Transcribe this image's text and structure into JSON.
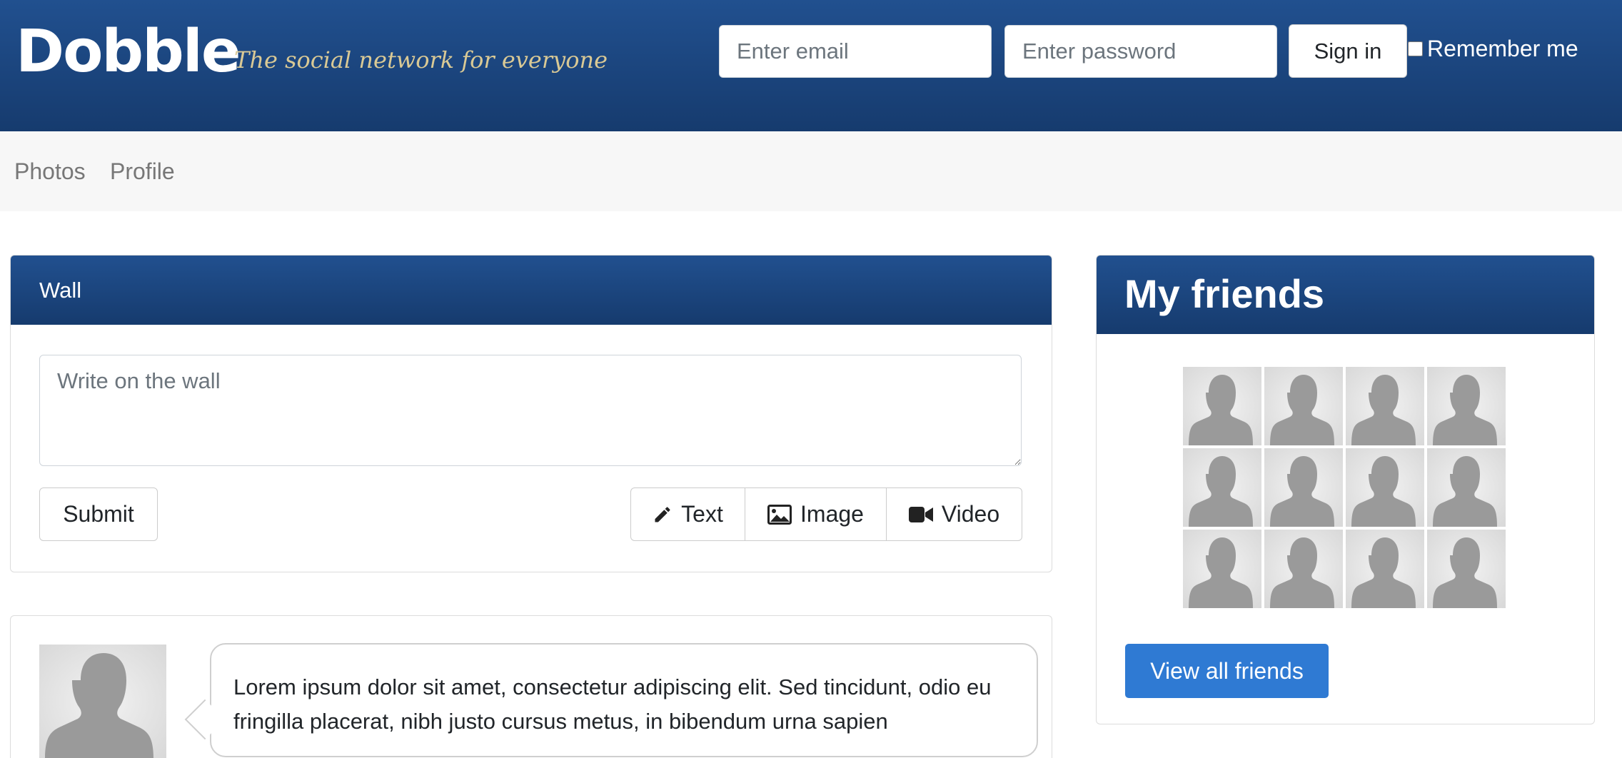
{
  "header": {
    "logo": "Dobble",
    "tagline": "The social network for everyone",
    "email_placeholder": "Enter email",
    "password_placeholder": "Enter password",
    "signin_label": "Sign in",
    "remember_label": "Remember me"
  },
  "nav": {
    "items": [
      {
        "label": "Photos"
      },
      {
        "label": "Profile"
      }
    ]
  },
  "wall": {
    "title": "Wall",
    "placeholder": "Write on the wall",
    "submit_label": "Submit",
    "type_buttons": [
      {
        "label": "Text",
        "icon": "pencil-icon"
      },
      {
        "label": "Image",
        "icon": "image-icon"
      },
      {
        "label": "Video",
        "icon": "video-camera-icon"
      }
    ]
  },
  "post": {
    "text": "Lorem ipsum dolor sit amet, consectetur adipiscing elit. Sed tincidunt, odio eu fringilla placerat, nibh justo cursus metus, in bibendum urna sapien"
  },
  "friends": {
    "title": "My friends",
    "count": 12,
    "view_all_label": "View all friends"
  },
  "colors": {
    "header_blue": "#1d4a87",
    "tagline_gold": "#d9c995",
    "button_blue": "#2f7ad3",
    "nav_bg": "#f7f7f7"
  }
}
